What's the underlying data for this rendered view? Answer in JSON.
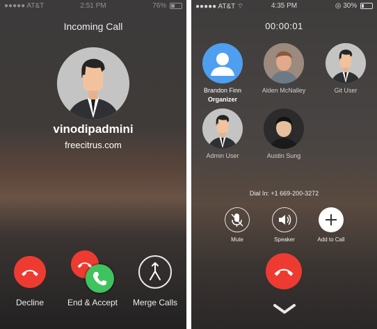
{
  "left": {
    "status": {
      "carrier": "●●●●● AT&T",
      "time": "2:51 PM",
      "battery": "76%"
    },
    "title": "Incoming Call",
    "caller": {
      "name": "vinodipadmini",
      "subtitle": "freecitrus.com"
    },
    "actions": [
      {
        "label": "Decline",
        "icon": "hangup-icon"
      },
      {
        "label": "End & Accept",
        "icon": "end-accept-icon"
      },
      {
        "label": "Merge Calls",
        "icon": "merge-calls-icon"
      }
    ]
  },
  "right": {
    "status": {
      "carrier": "●●●●● AT&T",
      "time": "4:35 PM",
      "battery": "30%"
    },
    "timer": "00:00:01",
    "participants": [
      {
        "name": "Brandon Finn",
        "role": "Organizer",
        "avatar": "default-user-icon"
      },
      {
        "name": "Alden McNalley",
        "avatar": "photo"
      },
      {
        "name": "Git User",
        "avatar": "man-illustration"
      },
      {
        "name": "Admin User",
        "avatar": "man-illustration"
      },
      {
        "name": "Austin Sung",
        "avatar": "photo"
      }
    ],
    "dial_in": "Dial In: +1 669-200-3272",
    "controls": [
      {
        "label": "Mute",
        "icon": "mute-mic-icon"
      },
      {
        "label": "Speaker",
        "icon": "speaker-icon"
      },
      {
        "label": "Add to Call",
        "icon": "plus-icon"
      }
    ],
    "colors": {
      "hangup": "#ee3b31",
      "accept": "#3fc35e"
    }
  }
}
